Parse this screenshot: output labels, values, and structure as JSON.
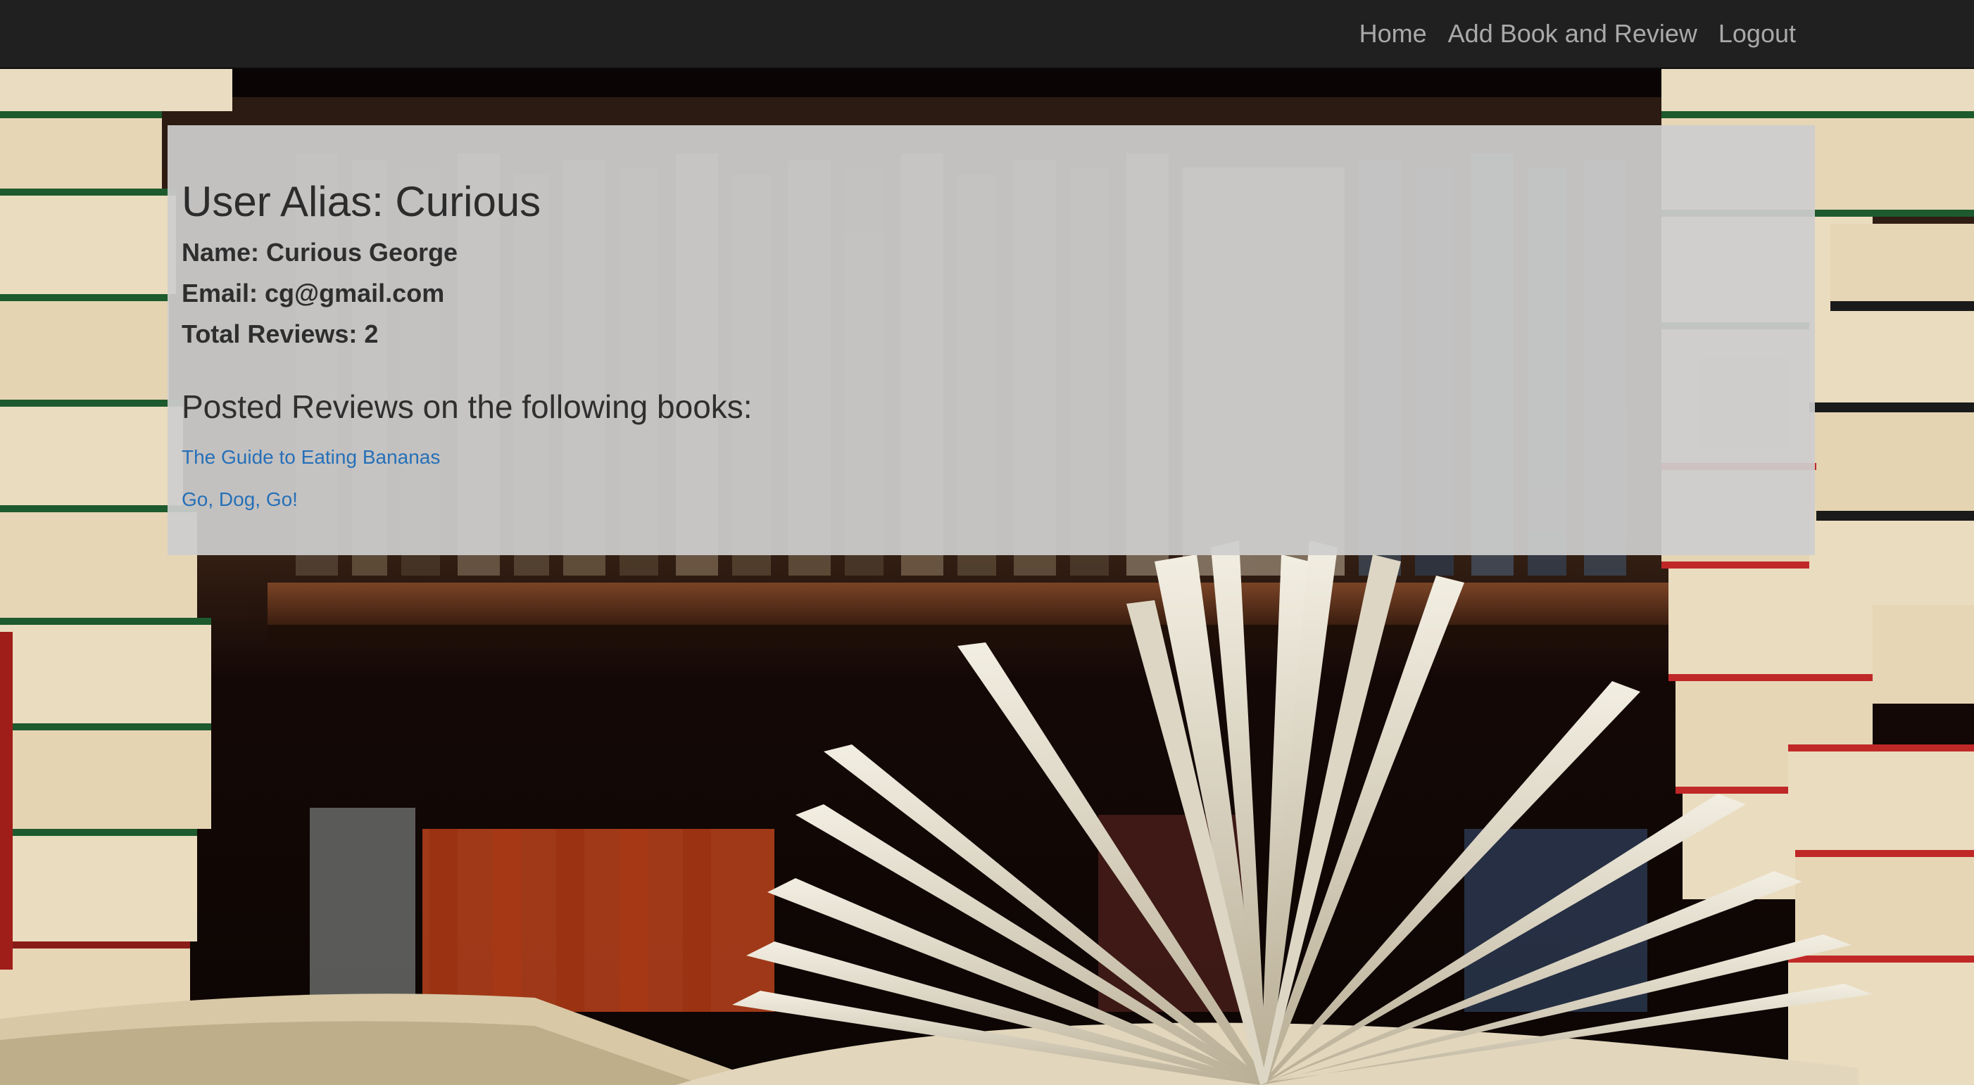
{
  "nav": {
    "links": [
      {
        "label": "Home"
      },
      {
        "label": "Add Book and Review"
      },
      {
        "label": "Logout"
      }
    ]
  },
  "profile": {
    "alias": "User Alias: Curious",
    "name": "Name: Curious George",
    "email": "Email: cg@gmail.com",
    "total_reviews": "Total Reviews: 2"
  },
  "reviews": {
    "heading": "Posted Reviews on the following books:",
    "books": [
      {
        "title": "The Guide to Eating Bananas"
      },
      {
        "title": "Go, Dog, Go!"
      }
    ]
  },
  "colors": {
    "navbar_bg": "#202020",
    "nav_link": "#a9a9a9",
    "panel_bg": "#cdcdcd",
    "link": "#2670b8",
    "text": "#2c2c2c"
  }
}
